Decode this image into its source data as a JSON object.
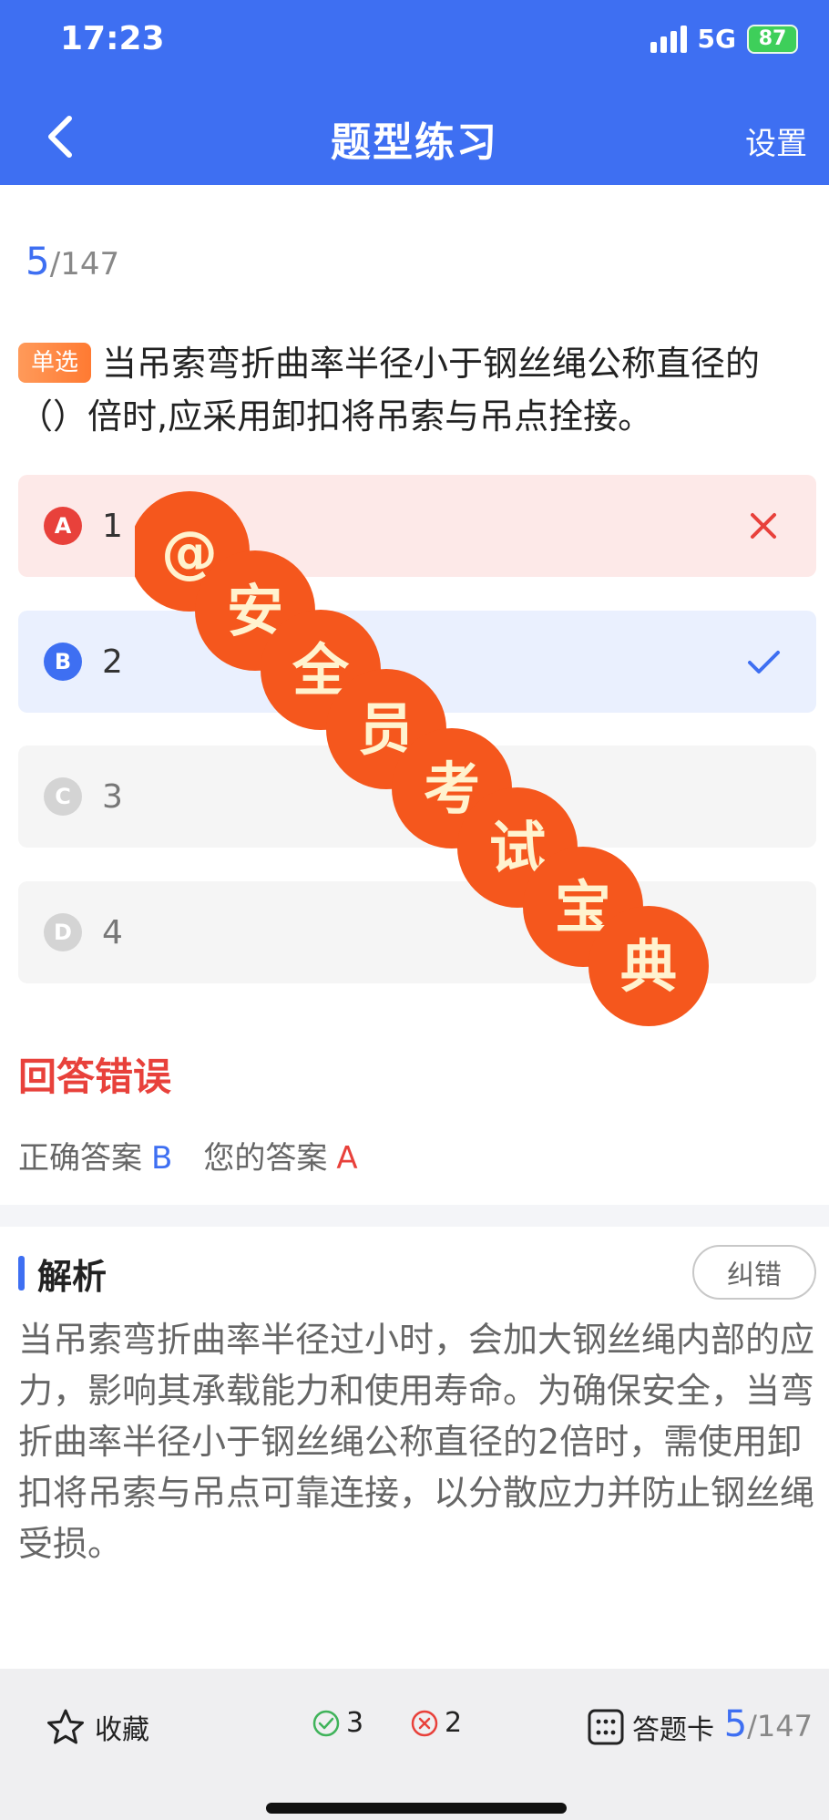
{
  "status": {
    "time": "17:23",
    "network": "5G",
    "battery": "87"
  },
  "nav": {
    "title": "题型练习",
    "settings": "设置"
  },
  "progress": {
    "current": "5",
    "total": "/147"
  },
  "question": {
    "tag": "单选",
    "text": "当吊索弯折曲率半径小于钢丝绳公称直径的（）倍时,应采用卸扣将吊索与吊点拴接。"
  },
  "options": [
    {
      "letter": "A",
      "text": "1",
      "state": "wrong"
    },
    {
      "letter": "B",
      "text": "2",
      "state": "correct"
    },
    {
      "letter": "C",
      "text": "3",
      "state": "none"
    },
    {
      "letter": "D",
      "text": "4",
      "state": "none"
    }
  ],
  "result": {
    "title": "回答错误",
    "correct_label": "正确答案",
    "correct_value": "B",
    "yours_label": "您的答案",
    "yours_value": "A"
  },
  "analysis": {
    "title": "解析",
    "report_label": "纠错",
    "text": "当吊索弯折曲率半径过小时，会加大钢丝绳内部的应力，影响其承载能力和使用寿命。为确保安全，当弯折曲率半径小于钢丝绳公称直径的2倍时，需使用卸扣将吊索与吊点可靠连接，以分散应力并防止钢丝绳受损。"
  },
  "watermark": {
    "chars": [
      "@",
      "安",
      "全",
      "员",
      "考",
      "试",
      "宝",
      "典"
    ]
  },
  "bottom": {
    "favorite_label": "收藏",
    "correct_count": "3",
    "wrong_count": "2",
    "card_label": "答题卡",
    "progress_current": "5",
    "progress_total": "/147"
  },
  "colors": {
    "accent": "#3e6ff2",
    "error": "#e8413b",
    "watermark": "#f5571d"
  }
}
